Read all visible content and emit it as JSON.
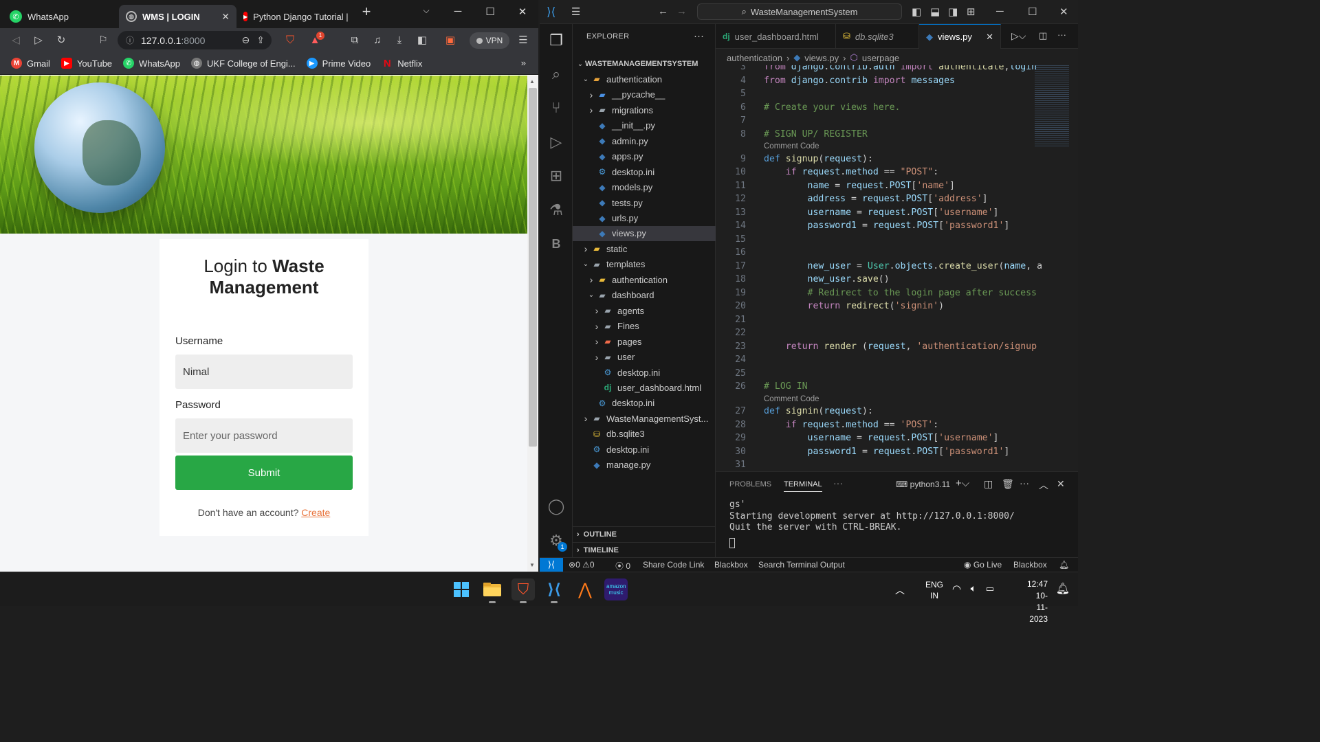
{
  "browser": {
    "tabs": [
      {
        "title": "WhatsApp",
        "icon": "whatsapp-icon"
      },
      {
        "title": "WMS | LOGIN",
        "icon": "globe-icon",
        "active": true
      },
      {
        "title": "Python Django Tutorial |",
        "icon": "youtube-icon"
      }
    ],
    "url_host": "127.0.0.1",
    "url_port": ":8000",
    "vpn_label": "VPN",
    "notification_count": "1",
    "bookmarks": [
      {
        "label": "Gmail",
        "icon": "gmail-icon",
        "color": "#ea4335"
      },
      {
        "label": "YouTube",
        "icon": "youtube-icon",
        "color": "#ff0000"
      },
      {
        "label": "WhatsApp",
        "icon": "whatsapp-icon",
        "color": "#25d366"
      },
      {
        "label": "UKF College of Engi...",
        "icon": "globe-icon",
        "color": "#888888"
      },
      {
        "label": "Prime Video",
        "icon": "prime-video-icon",
        "color": "#1a98ff"
      },
      {
        "label": "Netflix",
        "icon": "netflix-icon",
        "color": "#e50914"
      }
    ],
    "page": {
      "title_plain": "Login to ",
      "title_bold": "Waste Management",
      "username_label": "Username",
      "username_value": "Nimal",
      "password_label": "Password",
      "password_placeholder": "Enter your password",
      "submit_label": "Submit",
      "signup_prompt": "Don't have an account?",
      "signup_link": "Create",
      "accent_color": "#28a745",
      "link_color": "#e8723a"
    }
  },
  "vscode": {
    "search_text": "WasteManagementSystem",
    "explorer_title": "EXPLORER",
    "tree": [
      {
        "label": "WASTEMANAGEMENTSYSTEM",
        "depth": 0,
        "type": "root",
        "chev": "v"
      },
      {
        "label": "authentication",
        "depth": 1,
        "type": "folder-open",
        "chev": "v"
      },
      {
        "label": "__pycache__",
        "depth": 2,
        "type": "folder-blue",
        "chev": ">"
      },
      {
        "label": "migrations",
        "depth": 2,
        "type": "folder",
        "chev": ">"
      },
      {
        "label": "__init__.py",
        "depth": 2,
        "type": "py"
      },
      {
        "label": "admin.py",
        "depth": 2,
        "type": "py"
      },
      {
        "label": "apps.py",
        "depth": 2,
        "type": "py"
      },
      {
        "label": "desktop.ini",
        "depth": 2,
        "type": "gear"
      },
      {
        "label": "models.py",
        "depth": 2,
        "type": "py"
      },
      {
        "label": "tests.py",
        "depth": 2,
        "type": "py"
      },
      {
        "label": "urls.py",
        "depth": 2,
        "type": "py"
      },
      {
        "label": "views.py",
        "depth": 2,
        "type": "py",
        "selected": true
      },
      {
        "label": "static",
        "depth": 1,
        "type": "folder-yellow",
        "chev": ">"
      },
      {
        "label": "templates",
        "depth": 1,
        "type": "folder-open-grey",
        "chev": "v"
      },
      {
        "label": "authentication",
        "depth": 2,
        "type": "folder-yellow",
        "chev": ">"
      },
      {
        "label": "dashboard",
        "depth": 2,
        "type": "folder-open-grey",
        "chev": "v"
      },
      {
        "label": "agents",
        "depth": 3,
        "type": "folder",
        "chev": ">"
      },
      {
        "label": "Fines",
        "depth": 3,
        "type": "folder",
        "chev": ">"
      },
      {
        "label": "pages",
        "depth": 3,
        "type": "folder-orange",
        "chev": ">"
      },
      {
        "label": "user",
        "depth": 3,
        "type": "folder",
        "chev": ">"
      },
      {
        "label": "desktop.ini",
        "depth": 3,
        "type": "gear"
      },
      {
        "label": "user_dashboard.html",
        "depth": 3,
        "type": "dj"
      },
      {
        "label": "desktop.ini",
        "depth": 2,
        "type": "gear"
      },
      {
        "label": "WasteManagementSyst...",
        "depth": 1,
        "type": "folder",
        "chev": ">"
      },
      {
        "label": "db.sqlite3",
        "depth": 1,
        "type": "db"
      },
      {
        "label": "desktop.ini",
        "depth": 1,
        "type": "gear"
      },
      {
        "label": "manage.py",
        "depth": 1,
        "type": "py"
      }
    ],
    "outline_label": "OUTLINE",
    "timeline_label": "TIMELINE",
    "editor_tabs": [
      {
        "label": "user_dashboard.html",
        "icon": "django-icon"
      },
      {
        "label": "db.sqlite3",
        "icon": "database-icon",
        "italic": true
      },
      {
        "label": "views.py",
        "icon": "python-icon",
        "active": true
      }
    ],
    "breadcrumbs": [
      "authentication",
      "views.py",
      "userpage"
    ],
    "code_lines": [
      {
        "n": "3",
        "t": "from django.contrib.auth import authenticate,login"
      },
      {
        "n": "4",
        "t": "from django.contrib import messages"
      },
      {
        "n": "5",
        "t": ""
      },
      {
        "n": "6",
        "t": "# Create your views here."
      },
      {
        "n": "7",
        "t": ""
      },
      {
        "n": "8",
        "t": "# SIGN UP/ REGISTER"
      },
      {
        "n": "9",
        "t": "def signup(request):"
      },
      {
        "n": "10",
        "t": "    if request.method == \"POST\":"
      },
      {
        "n": "11",
        "t": "        name = request.POST['name']"
      },
      {
        "n": "12",
        "t": "        address = request.POST['address']"
      },
      {
        "n": "13",
        "t": "        username = request.POST['username']"
      },
      {
        "n": "14",
        "t": "        password1 = request.POST['password1']"
      },
      {
        "n": "15",
        "t": ""
      },
      {
        "n": "16",
        "t": ""
      },
      {
        "n": "17",
        "t": "        new_user = User.objects.create_user(name, a"
      },
      {
        "n": "18",
        "t": "        new_user.save()"
      },
      {
        "n": "19",
        "t": "        # Redirect to the login page after success"
      },
      {
        "n": "20",
        "t": "        return redirect('signin')"
      },
      {
        "n": "21",
        "t": ""
      },
      {
        "n": "22",
        "t": ""
      },
      {
        "n": "23",
        "t": "    return render (request, 'authentication/signup"
      },
      {
        "n": "24",
        "t": ""
      },
      {
        "n": "25",
        "t": ""
      },
      {
        "n": "26",
        "t": "# LOG IN"
      },
      {
        "n": "27",
        "t": "def signin(request):"
      },
      {
        "n": "28",
        "t": "    if request.method == 'POST':"
      },
      {
        "n": "29",
        "t": "        username = request.POST['username']"
      },
      {
        "n": "30",
        "t": "        password1 = request.POST['password1']"
      },
      {
        "n": "31",
        "t": ""
      }
    ],
    "codelens": "Comment Code",
    "panel_tabs": [
      "PROBLEMS",
      "TERMINAL"
    ],
    "terminal_profile": "python3.11",
    "terminal_lines": [
      "gs'",
      "Starting development server at http://127.0.0.1:8000/",
      "Quit the server with CTRL-BREAK."
    ],
    "status": {
      "errors": "0",
      "warnings": "0",
      "ports": "0",
      "share": "Share Code Link",
      "blackbox": "Blackbox",
      "search_terminal": "Search Terminal Output",
      "go_live": "Go Live",
      "blackbox_right": "Blackbox"
    },
    "accounts_badge": "1",
    "accent_color": "#0078d4"
  },
  "taskbar": {
    "lang_line1": "ENG",
    "lang_line2": "IN",
    "time": "12:47",
    "date": "10-11-2023",
    "amazon_music_label": "amazon music"
  }
}
